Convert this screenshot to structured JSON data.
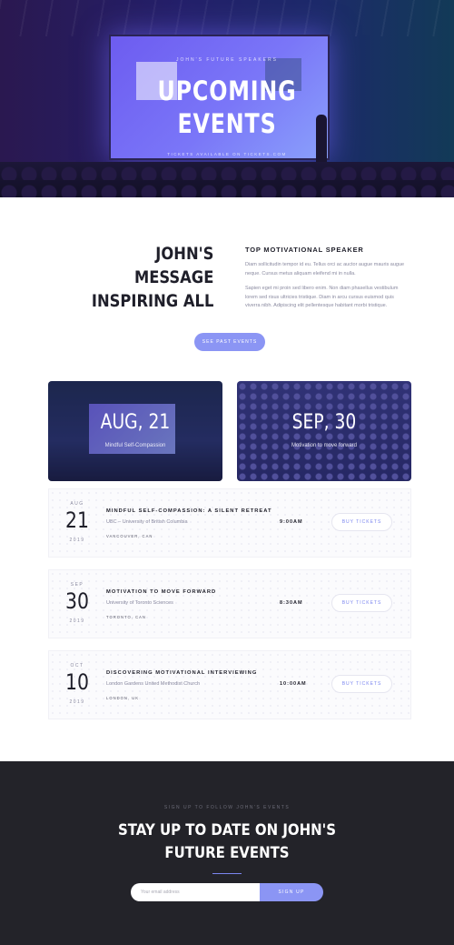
{
  "hero": {
    "kicker": "JOHN'S FUTURE SPEAKERS",
    "title_line1": "UPCOMING",
    "title_line2": "EVENTS",
    "tickets_note": "TICKETS AVAILABLE ON TICKETS.COM"
  },
  "message": {
    "heading_line1": "JOHN'S",
    "heading_line2": "MESSAGE",
    "heading_line3": "INSPIRING ALL",
    "subheading": "TOP MOTIVATIONAL SPEAKER",
    "paragraph1": "Diam sollicitudin tempor id eu. Tellus orci ac auctor augue mauris augue neque. Cursus metus aliquam eleifend mi in nulla.",
    "paragraph2": "Sapien eget mi proin sed libero enim. Non diam phasellus vestibulum lorem sed risus ultricies tristique. Diam in arcu cursus euismod quis viverra nibh. Adipiscing elit pellentesque habitant morbi tristique.",
    "button_label": "SEE PAST EVENTS"
  },
  "featured": [
    {
      "date": "AUG, 21",
      "caption": "Mindful Self-Compassion"
    },
    {
      "date": "SEP, 30",
      "caption": "Motivation to move forward"
    }
  ],
  "events": [
    {
      "month": "AUG",
      "day": "21",
      "year": "2019",
      "title": "MINDFUL SELF-COMPASSION: A SILENT RETREAT",
      "venue": "UBC – University of British Columbia",
      "city": "VANCOUVER, CAN",
      "time": "9:00AM",
      "button": "BUY TICKETS"
    },
    {
      "month": "SEP",
      "day": "30",
      "year": "2019",
      "title": "MOTIVATION TO MOVE FORWARD",
      "venue": "University of Toronto Sciences",
      "city": "TORONTO, CAN",
      "time": "8:30AM",
      "button": "BUY TICKETS"
    },
    {
      "month": "OCT",
      "day": "10",
      "year": "2019",
      "title": "DISCOVERING MOTIVATIONAL INTERVIEWING",
      "venue": "London Gardens United Methodist Church",
      "city": "LONDON, UK",
      "time": "10:00AM",
      "button": "BUY TICKETS"
    }
  ],
  "signup": {
    "kicker": "SIGN UP TO FOLLOW JOHN'S EVENTS",
    "heading_line1": "STAY UP TO DATE ON JOHN'S",
    "heading_line2": "FUTURE EVENTS",
    "email_placeholder": "Your email address",
    "button_label": "SIGN UP"
  },
  "colors": {
    "accent": "#8b95f4",
    "dark_footer": "#232329",
    "heading_text": "#1f1f2a",
    "body_text": "#8a8aa0"
  }
}
